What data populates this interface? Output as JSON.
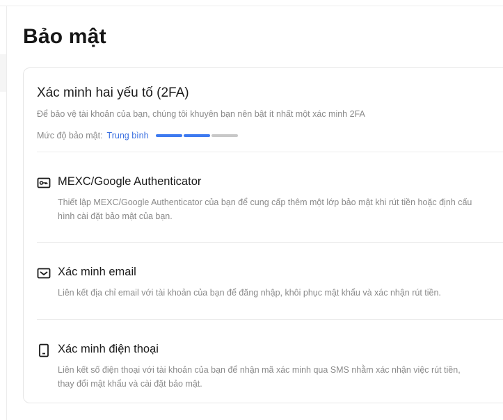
{
  "page": {
    "title": "Bảo mật"
  },
  "twofa": {
    "title": "Xác minh hai yếu tố (2FA)",
    "description": "Để bảo vệ tài khoản của bạn, chúng tôi khuyên bạn nên bật ít nhất một xác minh 2FA",
    "level_label": "Mức độ bảo mật:",
    "level_value": "Trung bình",
    "level_segments_filled": 2,
    "level_segments_total": 3,
    "items": [
      {
        "icon": "key-icon",
        "title": "MEXC/Google Authenticator",
        "description": "Thiết lập MEXC/Google Authenticator của bạn để cung cấp thêm một lớp bảo mật khi rút tiền hoặc định cấu hình cài đặt bảo mật của bạn."
      },
      {
        "icon": "email-icon",
        "title": "Xác minh email",
        "description": "Liên kết địa chỉ email với tài khoản của bạn để đăng nhập, khôi phục mật khẩu và xác nhận rút tiền."
      },
      {
        "icon": "phone-icon",
        "title": "Xác minh điện thoại",
        "description": "Liên kết số điện thoại với tài khoản của bạn để nhận mã xác minh qua SMS nhằm xác nhận việc rút tiền, thay đổi mật khẩu và cài đặt bảo mật."
      }
    ]
  },
  "colors": {
    "accent": "#3d7af0",
    "level_text": "#3a6fe0",
    "muted_text": "#8a8a8a",
    "border": "#e6e6e6"
  }
}
